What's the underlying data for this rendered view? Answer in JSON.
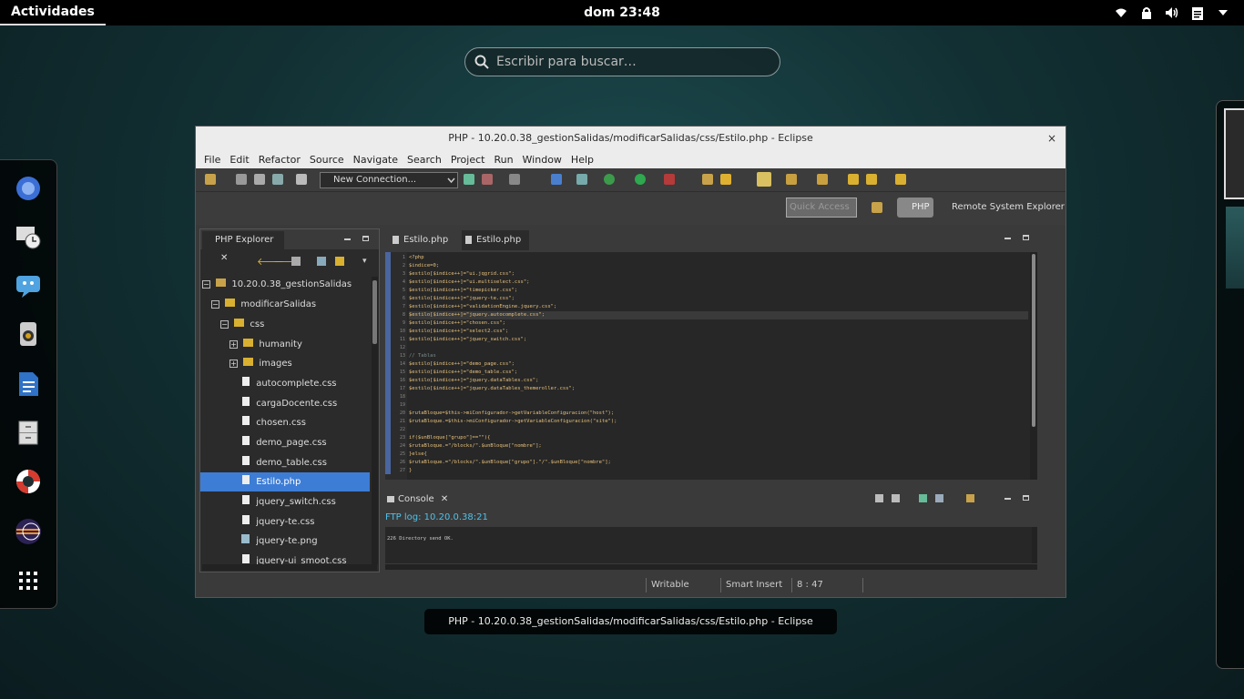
{
  "topbar": {
    "activities": "Actividades",
    "clock": "dom 23:48"
  },
  "search": {
    "placeholder": "Escribir para buscar…"
  },
  "window": {
    "title": "PHP - 10.20.0.38_gestionSalidas/modificarSalidas/css/Estilo.php - Eclipse",
    "close": "×",
    "menu": [
      "File",
      "Edit",
      "Refactor",
      "Source",
      "Navigate",
      "Search",
      "Project",
      "Run",
      "Window",
      "Help"
    ],
    "connection": "New Connection...",
    "quick_access": "Quick Access",
    "perspective_php": "PHP",
    "perspective_rse": "Remote System Explorer"
  },
  "explorer": {
    "tab": "PHP Explorer",
    "items": [
      {
        "label": "10.20.0.38_gestionSalidas",
        "depth": 0,
        "type": "project"
      },
      {
        "label": "modificarSalidas",
        "depth": 1,
        "type": "folder"
      },
      {
        "label": "css",
        "depth": 2,
        "type": "folder"
      },
      {
        "label": "humanity",
        "depth": 3,
        "type": "folder-collapsed"
      },
      {
        "label": "images",
        "depth": 3,
        "type": "folder-collapsed"
      },
      {
        "label": "autocomplete.css",
        "depth": 3,
        "type": "file"
      },
      {
        "label": "cargaDocente.css",
        "depth": 3,
        "type": "file"
      },
      {
        "label": "chosen.css",
        "depth": 3,
        "type": "file"
      },
      {
        "label": "demo_page.css",
        "depth": 3,
        "type": "file"
      },
      {
        "label": "demo_table.css",
        "depth": 3,
        "type": "file"
      },
      {
        "label": "Estilo.php",
        "depth": 3,
        "type": "file",
        "selected": true
      },
      {
        "label": "jquery_switch.css",
        "depth": 3,
        "type": "file"
      },
      {
        "label": "jquery-te.css",
        "depth": 3,
        "type": "file"
      },
      {
        "label": "jquery-te.png",
        "depth": 3,
        "type": "image"
      },
      {
        "label": "jquery-ui_smoot.css",
        "depth": 3,
        "type": "file"
      }
    ]
  },
  "editor": {
    "tabs": [
      "Estilo.php",
      "Estilo.php"
    ],
    "lines": [
      "<?php",
      "$indice=0;",
      "$estilo[$indice++]=\"ui.jqgrid.css\";",
      "$estilo[$indice++]=\"ui.multiselect.css\";",
      "$estilo[$indice++]=\"timepicker.css\";",
      "$estilo[$indice++]=\"jquery-te.css\";",
      "$estilo[$indice++]=\"validationEngine.jquery.css\";",
      "$estilo[$indice++]=\"jquery.autocomplete.css\";",
      "$estilo[$indice++]=\"chosen.css\";",
      "$estilo[$indice++]=\"select2.css\";",
      "$estilo[$indice++]=\"jquery_switch.css\";",
      "",
      "// Tablas",
      "$estilo[$indice++]=\"demo_page.css\";",
      "$estilo[$indice++]=\"demo_table.css\";",
      "$estilo[$indice++]=\"jquery.dataTables.css\";",
      "$estilo[$indice++]=\"jquery.dataTables_themeroller.css\";",
      "",
      "",
      "$rutaBloque=$this->miConfigurador->getVariableConfiguracion(\"host\");",
      "$rutaBloque.=$this->miConfigurador->getVariableConfiguracion(\"site\");",
      "",
      "if($unBloque[\"grupo\"]==\"\"){",
      "    $rutaBloque.=\"/blocks/\".$unBloque[\"nombre\"];",
      "}else{",
      "    $rutaBloque.=\"/blocks/\".$unBloque[\"grupo\"].\"/\".$unBloque[\"nombre\"];",
      "}"
    ]
  },
  "console": {
    "tab": "Console",
    "header": "FTP log: 10.20.0.38:21",
    "line": "226 Directory send OK."
  },
  "status": {
    "writable": "Writable",
    "insert": "Smart Insert",
    "position": "8 : 47"
  },
  "caption": "PHP - 10.20.0.38_gestionSalidas/modificarSalidas/css/Estilo.php - Eclipse"
}
